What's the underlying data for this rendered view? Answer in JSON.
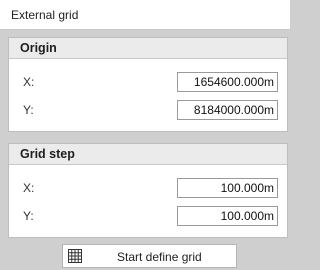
{
  "window": {
    "title": "External grid"
  },
  "origin": {
    "heading": "Origin",
    "x_label": "X:",
    "x_value": "1654600.000m",
    "y_label": "Y:",
    "y_value": "8184000.000m"
  },
  "grid_step": {
    "heading": "Grid step",
    "x_label": "X:",
    "x_value": "100.000m",
    "y_label": "Y:",
    "y_value": "100.000m"
  },
  "action": {
    "label": "Start define grid",
    "icon": "grid-icon"
  }
}
